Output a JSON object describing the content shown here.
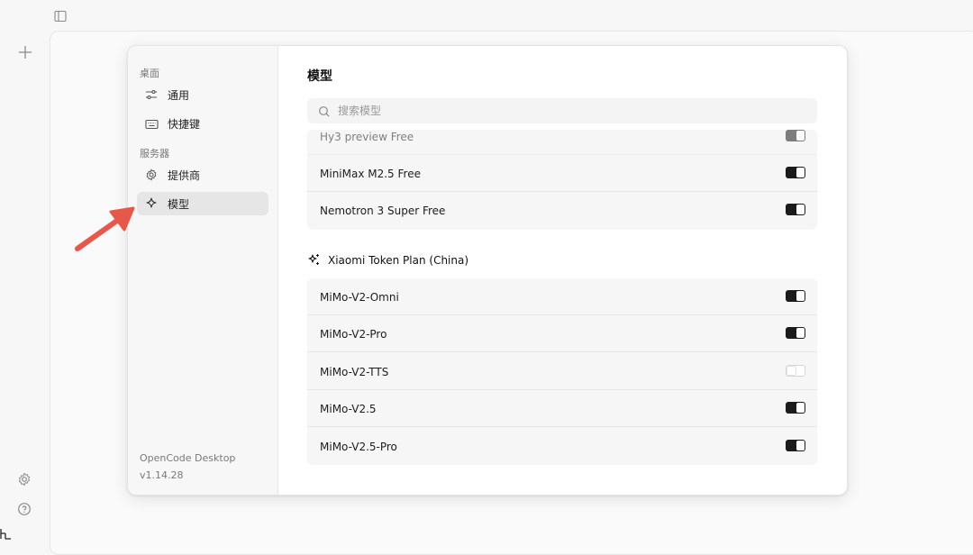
{
  "settings": {
    "sections": [
      {
        "heading": "桌面",
        "items": [
          {
            "label": "通用",
            "icon": "sliders-icon"
          },
          {
            "label": "快捷键",
            "icon": "keyboard-icon"
          }
        ]
      },
      {
        "heading": "服务器",
        "items": [
          {
            "label": "提供商",
            "icon": "gear-icon"
          },
          {
            "label": "模型",
            "icon": "sparkle-icon",
            "active": true
          }
        ]
      }
    ],
    "footer": {
      "app_name": "OpenCode Desktop",
      "version": "v1.14.28"
    }
  },
  "main": {
    "title": "模型",
    "search": {
      "placeholder": "搜索模型",
      "value": ""
    },
    "group1": {
      "models": [
        {
          "name": "Hy3 preview Free",
          "enabled": true,
          "partially_visible": true
        },
        {
          "name": "MiniMax M2.5 Free",
          "enabled": true
        },
        {
          "name": "Nemotron 3 Super Free",
          "enabled": true
        }
      ]
    },
    "group2": {
      "title": "Xiaomi Token Plan (China)",
      "icon": "sparkles-icon",
      "models": [
        {
          "name": "MiMo-V2-Omni",
          "enabled": true
        },
        {
          "name": "MiMo-V2-Pro",
          "enabled": true
        },
        {
          "name": "MiMo-V2-TTS",
          "enabled": false
        },
        {
          "name": "MiMo-V2.5",
          "enabled": true
        },
        {
          "name": "MiMo-V2.5-Pro",
          "enabled": true
        }
      ]
    }
  },
  "colors": {
    "accent": "#1b1b1b",
    "annotation_arrow": "#e8584a"
  }
}
